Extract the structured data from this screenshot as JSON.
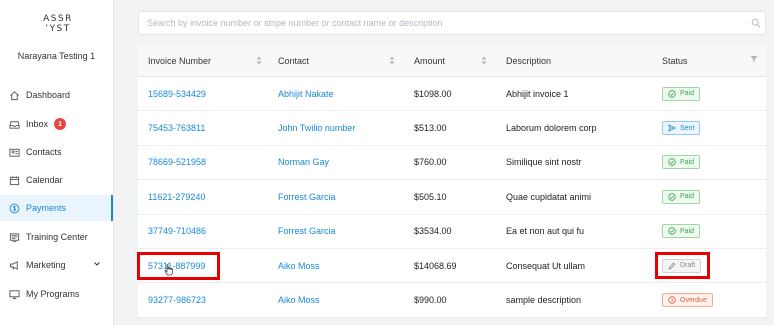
{
  "sidebar": {
    "logo_line1": "ASSR",
    "logo_line2": "ʼYST",
    "account": "Narayana Testing 1",
    "items": [
      {
        "label": "Dashboard",
        "icon": "home-icon"
      },
      {
        "label": "Inbox",
        "icon": "inbox-icon",
        "badge": "1"
      },
      {
        "label": "Contacts",
        "icon": "contact-card-icon"
      },
      {
        "label": "Calendar",
        "icon": "calendar-icon"
      },
      {
        "label": "Payments",
        "icon": "dollar-circle-icon",
        "active": true
      },
      {
        "label": "Training Center",
        "icon": "training-icon"
      },
      {
        "label": "Marketing",
        "icon": "megaphone-icon"
      },
      {
        "label": "My Programs",
        "icon": "monitor-icon"
      }
    ]
  },
  "search": {
    "placeholder": "Search by invoice number or stripe number or contact name or description"
  },
  "table": {
    "columns": [
      "Invoice Number",
      "Contact",
      "Amount",
      "Description",
      "Status"
    ],
    "rows": [
      {
        "invoice": "15689-534429",
        "contact": "Abhijit Nakate",
        "amount": "$1098.00",
        "description": "Abhijit invoice 1",
        "status": "Paid"
      },
      {
        "invoice": "75453-763811",
        "contact": "John Twilio number",
        "amount": "$513.00",
        "description": "Laborum dolorem corp",
        "status": "Sent"
      },
      {
        "invoice": "78669-521958",
        "contact": "Norman Gay",
        "amount": "$760.00",
        "description": "Similique sint nostr",
        "status": "Paid"
      },
      {
        "invoice": "11621-279240",
        "contact": "Forrest Garcia",
        "amount": "$505.10",
        "description": "Quae cupidatat animi",
        "status": "Paid"
      },
      {
        "invoice": "37749-710486",
        "contact": "Forrest Garcia",
        "amount": "$3534.00",
        "description": "Ea et non aut qui fu",
        "status": "Paid"
      },
      {
        "invoice": "57311-887999",
        "contact": "Aiko Moss",
        "amount": "$14068.69",
        "description": "Consequat Ut ullam",
        "status": "Draft"
      },
      {
        "invoice": "93277-986723",
        "contact": "Aiko Moss",
        "amount": "$990.00",
        "description": "sample description",
        "status": "Overdue"
      }
    ]
  },
  "colors": {
    "accent": "#1a8ad4",
    "paid": "#3aa64a",
    "overdue": "#e1633a",
    "badge": "#e4473e",
    "highlight": "#e60000"
  }
}
